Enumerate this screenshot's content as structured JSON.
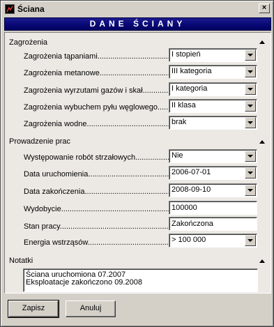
{
  "window": {
    "title": "Ściana",
    "close_label": "×"
  },
  "banner": {
    "text": "DANE ŚCIANY"
  },
  "sections": {
    "zagrozenia": {
      "title": "Zagrożenia",
      "rows": [
        {
          "label": "Zagrożenia tąpaniami",
          "value": "I stopień"
        },
        {
          "label": "Zagrożenia metanowe",
          "value": "III kategoria"
        },
        {
          "label": "Zagrożenia wyrzutami gazów i skał",
          "value": "I kategoria"
        },
        {
          "label": "Zagrożenia wybuchem pyłu węglowego",
          "value": "II klasa"
        },
        {
          "label": "Zagrożenia wodne",
          "value": "brak"
        }
      ]
    },
    "prowadzenie": {
      "title": "Prowadzenie prac",
      "rows": [
        {
          "label": "Występowanie robót strzałowych",
          "value": "Nie",
          "type": "combo"
        },
        {
          "label": "Data uruchomienia",
          "value": "2006-07-01",
          "type": "combo"
        },
        {
          "label": "Data zakończenia",
          "value": "2008-09-10",
          "type": "combo"
        },
        {
          "label": "Wydobycie",
          "value": "100000",
          "type": "text"
        },
        {
          "label": "Stan pracy",
          "value": "Zakończona",
          "type": "text"
        },
        {
          "label": "Energia wstrząsów",
          "value": "> 100 000",
          "type": "combo"
        }
      ]
    },
    "notatki": {
      "title": "Notatki",
      "lines": [
        "Ściana uruchomiona 07.2007",
        "Eksploatacje zakończono 09.2008"
      ]
    }
  },
  "buttons": {
    "save": "Zapisz",
    "cancel": "Anuluj"
  }
}
